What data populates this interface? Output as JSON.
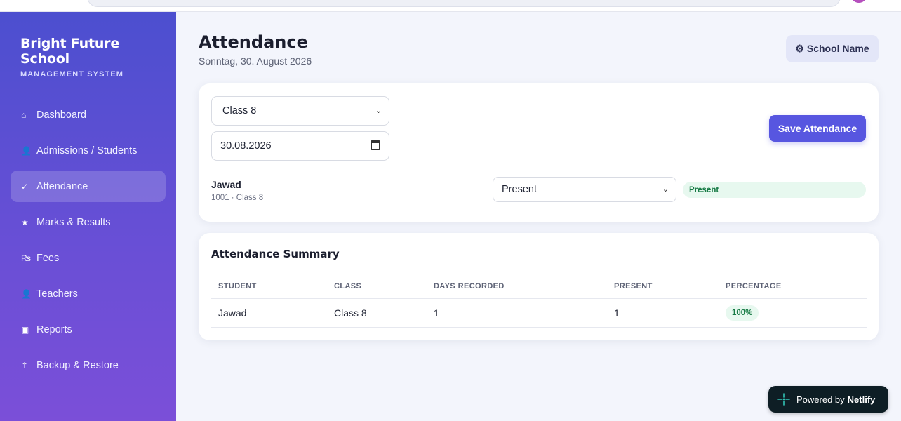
{
  "sidebar": {
    "brand_title": "Bright Future School",
    "brand_subtitle": "MANAGEMENT SYSTEM",
    "items": [
      {
        "label": "Dashboard",
        "icon": "⌂",
        "active": false
      },
      {
        "label": "Admissions / Students",
        "icon": "👤",
        "active": false
      },
      {
        "label": "Attendance",
        "icon": "✓",
        "active": true
      },
      {
        "label": "Marks & Results",
        "icon": "★",
        "active": false
      },
      {
        "label": "Fees",
        "icon": "₨",
        "active": false
      },
      {
        "label": "Teachers",
        "icon": "👤",
        "active": false
      },
      {
        "label": "Reports",
        "icon": "▣",
        "active": false
      },
      {
        "label": "Backup & Restore",
        "icon": "↥",
        "active": false
      }
    ]
  },
  "header": {
    "title": "Attendance",
    "date": "Sonntag, 30. August 2026",
    "school_button": "⚙ School Name"
  },
  "attendance_form": {
    "class_value": "Class 8",
    "date_value": "30.08.2026",
    "save_label": "Save Attendance",
    "student": {
      "name": "Jawad",
      "meta": "1001 · Class 8",
      "status_value": "Present",
      "status_badge": "Present"
    }
  },
  "summary": {
    "title": "Attendance Summary",
    "columns": [
      "STUDENT",
      "CLASS",
      "DAYS RECORDED",
      "PRESENT",
      "PERCENTAGE"
    ],
    "rows": [
      {
        "student": "Jawad",
        "class": "Class 8",
        "days": "1",
        "present": "1",
        "percentage": "100%"
      }
    ]
  },
  "netlify": {
    "prefix": "Powered by",
    "brand": "Netlify"
  },
  "colors": {
    "accent": "#5756e0",
    "success_bg": "#e7f8ef",
    "success_text": "#167a44"
  }
}
